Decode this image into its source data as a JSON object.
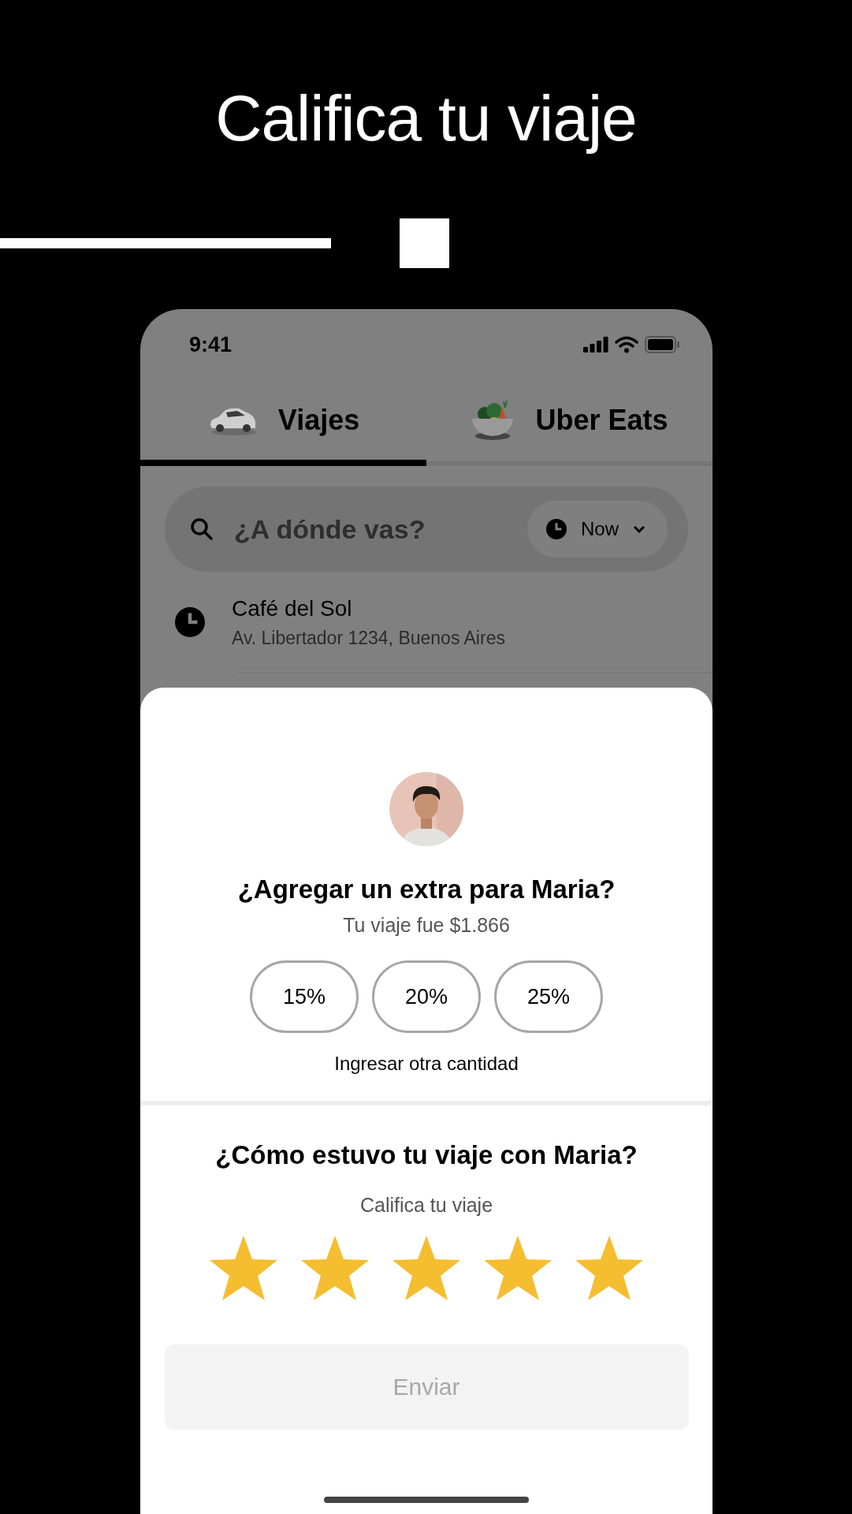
{
  "headline": "Califica tu viaje",
  "status_bar": {
    "time": "9:41"
  },
  "tabs": [
    {
      "label": "Viajes",
      "kind": "car",
      "selected": true
    },
    {
      "label": "Uber Eats",
      "kind": "bowl",
      "selected": false
    }
  ],
  "search": {
    "placeholder": "¿A dónde vas?",
    "time_chip": "Now"
  },
  "recent_places": [
    {
      "name": "Café del Sol",
      "address": "Av. Libertador 1234, Buenos Aires"
    }
  ],
  "tip_sheet": {
    "title": "¿Agregar un extra para Maria?",
    "fare": "Tu viaje fue $1.866",
    "tip_options": [
      {
        "label": "15%",
        "selected": false
      },
      {
        "label": "20%",
        "selected": false
      },
      {
        "label": "25%",
        "selected": false
      }
    ],
    "custom_amount": "Ingresar otra cantidad"
  },
  "rating": {
    "title": "¿Cómo estuvo tu viaje con Maria?",
    "prompt": "Califica tu viaje",
    "stars": 5
  },
  "submit": {
    "label": "Enviar",
    "disabled": true
  }
}
